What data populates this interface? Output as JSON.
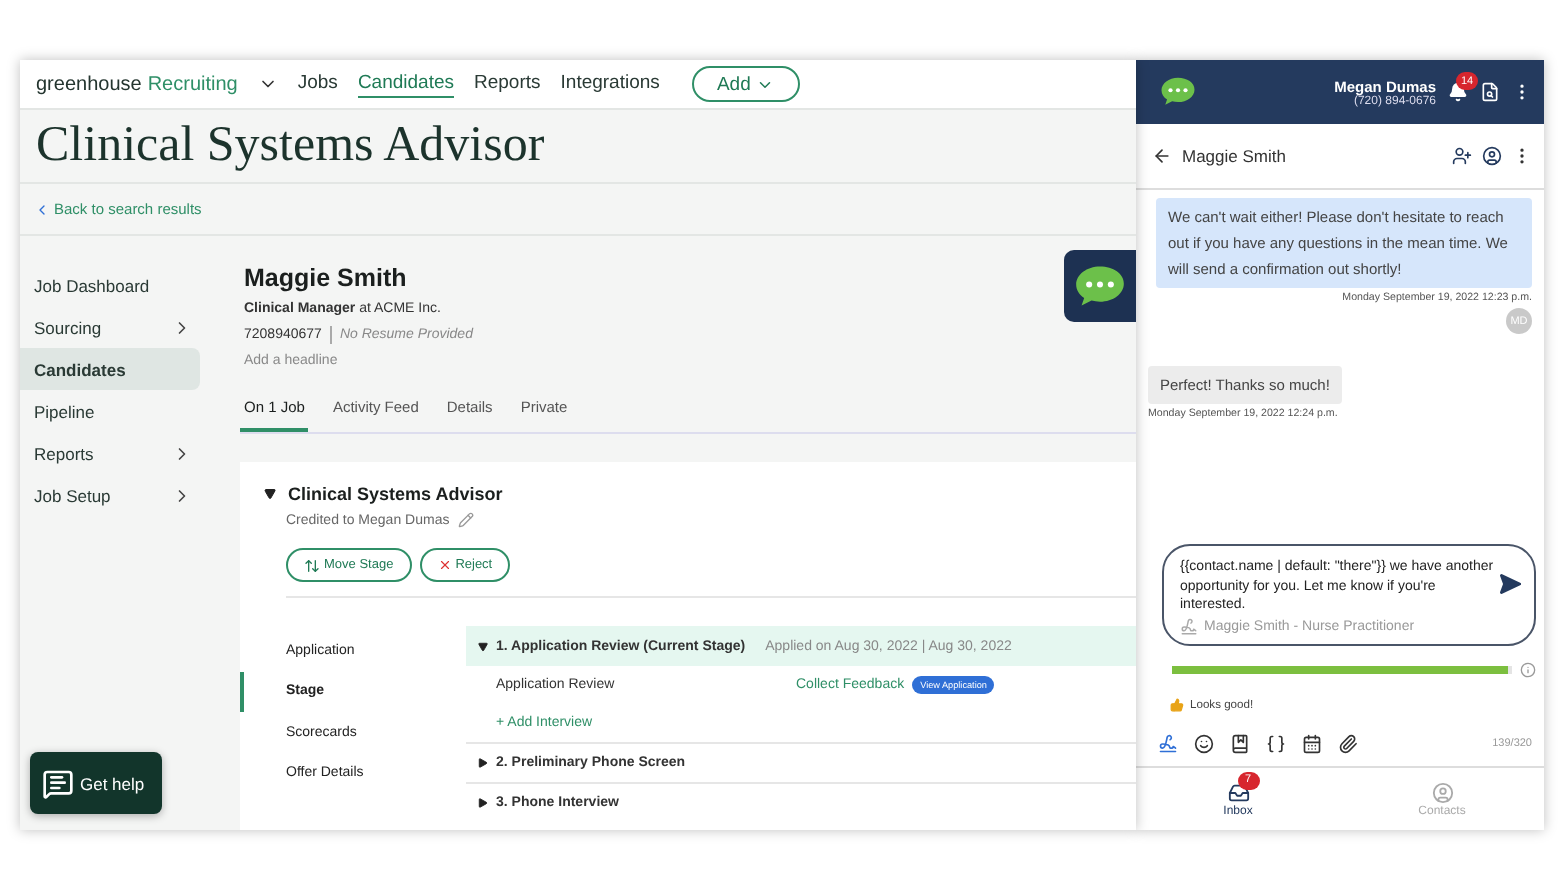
{
  "app": {
    "brand": "greenhouse",
    "product": "Recruiting",
    "nav": [
      {
        "label": "Jobs",
        "selected": false
      },
      {
        "label": "Candidates",
        "selected": true
      },
      {
        "label": "Reports",
        "selected": false
      },
      {
        "label": "Integrations",
        "selected": false
      }
    ],
    "add_button": "Add"
  },
  "page_title": "Clinical Systems Advisor",
  "back_link": "Back to search results",
  "sidebar": [
    {
      "label": "Job Dashboard",
      "selected": false,
      "has_submenu": false
    },
    {
      "label": "Sourcing",
      "selected": false,
      "has_submenu": true
    },
    {
      "label": "Candidates",
      "selected": true,
      "has_submenu": false
    },
    {
      "label": "Pipeline",
      "selected": false,
      "has_submenu": false
    },
    {
      "label": "Reports",
      "selected": false,
      "has_submenu": true
    },
    {
      "label": "Job Setup",
      "selected": false,
      "has_submenu": true
    }
  ],
  "candidate": {
    "name": "Maggie Smith",
    "role": "**Clinical Manager** at ACME Inc.",
    "phone": "7208940677",
    "resume": "No Resume Provided",
    "headline": "Add a headline"
  },
  "tabs": [
    {
      "label": "On 1 Job",
      "selected": true
    },
    {
      "label": "Activity Feed",
      "selected": false
    },
    {
      "label": "Details",
      "selected": false
    },
    {
      "label": "Private",
      "selected": false
    }
  ],
  "job": {
    "title": "Clinical Systems Advisor",
    "credited": "Credited to Megan Dumas",
    "actions": [
      {
        "kind": "move",
        "label": "Move Stage"
      },
      {
        "kind": "reject",
        "label": "Reject"
      }
    ],
    "sections": [
      {
        "label": "Application",
        "selected": false
      },
      {
        "label": "Stage",
        "selected": true
      },
      {
        "label": "Scorecards",
        "selected": false
      },
      {
        "label": "Offer Details",
        "selected": false
      }
    ],
    "stages": [
      {
        "number": "1.",
        "name": "Application Review (Current Stage)",
        "expanded": true,
        "meta": "Applied on Aug 30, 2022 | Aug 30, 2022",
        "interview": "Application Review",
        "feedback_link": "Collect Feedback",
        "view_button": "View Application",
        "add_link": "+ Add Interview"
      },
      {
        "number": "2.",
        "name": "Preliminary Phone Screen",
        "expanded": false
      },
      {
        "number": "3.",
        "name": "Phone Interview",
        "expanded": false
      }
    ]
  },
  "get_help": "Get help",
  "chat": {
    "agent_name": "Megan Dumas",
    "agent_phone": "(720) 894-0676",
    "notifications": "14",
    "contact": "Maggie Smith",
    "messages": [
      {
        "kind": "outgoing",
        "text": "We can't wait either! Please don't hesitate to reach out if you have any questions in the mean time. We will send a confirmation out shortly!",
        "time": "Monday September 19, 2022 12:23 p.m.",
        "avatar": "MD"
      },
      {
        "kind": "incoming",
        "text": "Perfect! Thanks so much!",
        "time": "Monday September 19, 2022 12:24 p.m."
      }
    ],
    "composer": {
      "value": "{{contact.name | default: \"there\"}} we have another opportunity for you. Let me know if you're interested.",
      "signature": "Maggie Smith - Nurse Practitioner"
    },
    "quality": {
      "level": 0.99
    },
    "feedback": "Looks good!",
    "char_count": "139/320",
    "footer_tabs": [
      {
        "kind": "inbox",
        "label": "Inbox",
        "badge": "7",
        "selected": true
      },
      {
        "kind": "contacts",
        "label": "Contacts",
        "selected": false
      }
    ]
  }
}
